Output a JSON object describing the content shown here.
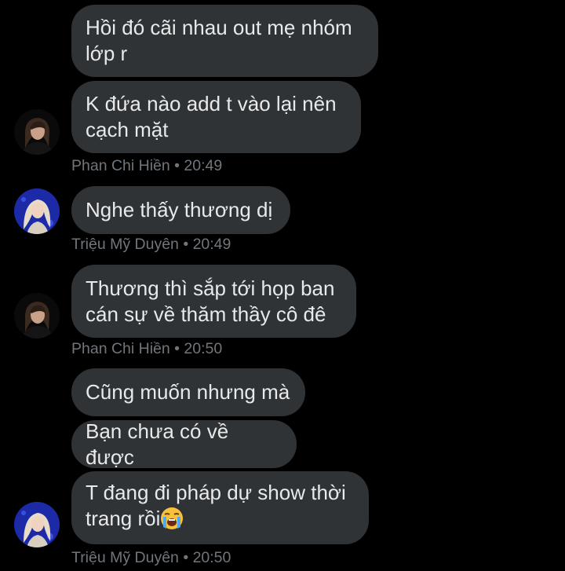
{
  "conversation": {
    "groups": [
      {
        "sender": "Phan Chi Hiền",
        "time": "20:49",
        "messages": [
          "Hồi đó cãi nhau out mẹ nhóm lớp r",
          "K đứa nào add t vào lại nên cạch mặt"
        ]
      },
      {
        "sender": "Triệu Mỹ Duyên",
        "time": "20:49",
        "messages": [
          "Nghe thấy thương dị"
        ]
      },
      {
        "sender": "Phan Chi Hiền",
        "time": "20:50",
        "messages": [
          "Thương thì sắp tới họp ban cán sự về thăm thầy cô đê"
        ]
      },
      {
        "sender": "Triệu Mỹ Duyên",
        "time": "20:50",
        "messages": [
          "Cũng muốn nhưng mà",
          "Bạn chưa có về được",
          "T đang đi pháp dự show thời trang rồi"
        ]
      }
    ],
    "separator": "•",
    "emoji": "loudly-crying-face-emoji"
  },
  "colors": {
    "background": "#000000",
    "bubble": "#2f3336",
    "text": "#e7e9ea",
    "meta": "#71767b"
  }
}
